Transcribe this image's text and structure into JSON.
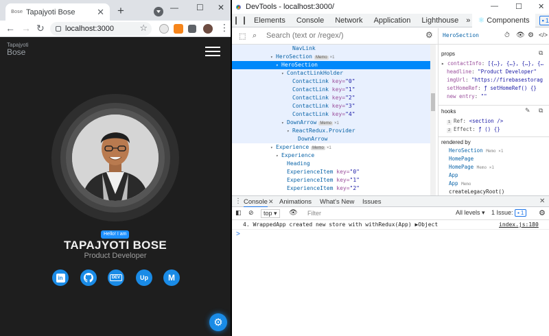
{
  "browser": {
    "tab_title": "Tapajyoti Bose",
    "tab_favicon_text": "Bose",
    "url": "localhost:3000",
    "new_tab_label": "+",
    "close_tab_label": "✕"
  },
  "site": {
    "logo_top": "Tapajyoti",
    "logo_bottom": "Bose",
    "hello_badge": "Hello! I am",
    "name": "TAPAJYOTI BOSE",
    "role": "Product Developer",
    "socials": [
      {
        "icon": "linkedin-icon",
        "label": "in"
      },
      {
        "icon": "github-icon",
        "label": "GH"
      },
      {
        "icon": "dev-icon",
        "label": "DEV"
      },
      {
        "icon": "upwork-icon",
        "label": "Up"
      },
      {
        "icon": "medium-icon",
        "label": "M"
      }
    ],
    "colors": {
      "accent": "#1a8be6",
      "background": "#1e1e1e"
    }
  },
  "devtools": {
    "window_title": "DevTools - localhost:3000/",
    "tabs": [
      "Elements",
      "Console",
      "Network",
      "Application",
      "Lighthouse",
      "Components"
    ],
    "active_tab": "Components",
    "issues_badge": "1",
    "search_placeholder": "Search (text or /regex/)",
    "tree": [
      {
        "name": "NavLink",
        "depth": 10,
        "state": "hl"
      },
      {
        "name": "HeroSection",
        "depth": 7,
        "memo": "Memo",
        "x1": "×1",
        "arrow": "▾",
        "state": "hl"
      },
      {
        "name": "HeroSection",
        "depth": 8,
        "arrow": "▾",
        "state": "sel"
      },
      {
        "name": "ContactLinkHolder",
        "depth": 9,
        "arrow": "▾",
        "state": "hl"
      },
      {
        "name": "ContactLink",
        "depth": 10,
        "key": "\"0\"",
        "state": "hl"
      },
      {
        "name": "ContactLink",
        "depth": 10,
        "key": "\"1\"",
        "state": "hl"
      },
      {
        "name": "ContactLink",
        "depth": 10,
        "key": "\"2\"",
        "state": "hl"
      },
      {
        "name": "ContactLink",
        "depth": 10,
        "key": "\"3\"",
        "state": "hl"
      },
      {
        "name": "ContactLink",
        "depth": 10,
        "key": "\"4\"",
        "state": "hl"
      },
      {
        "name": "DownArrow",
        "depth": 9,
        "memo": "Memo",
        "x1": "×1",
        "arrow": "▾",
        "state": "hl"
      },
      {
        "name": "ReactRedux.Provider",
        "depth": 10,
        "arrow": "▾",
        "state": "hl"
      },
      {
        "name": "DownArrow",
        "depth": 11,
        "state": "hl"
      },
      {
        "name": "Experience",
        "depth": 7,
        "memo": "Memo",
        "x1": "×1",
        "arrow": "▾",
        "state": ""
      },
      {
        "name": "Experience",
        "depth": 8,
        "arrow": "▾",
        "state": ""
      },
      {
        "name": "Heading",
        "depth": 9,
        "state": ""
      },
      {
        "name": "ExperienceItem",
        "depth": 9,
        "key": "\"0\"",
        "state": ""
      },
      {
        "name": "ExperienceItem",
        "depth": 9,
        "key": "\"1\"",
        "state": ""
      },
      {
        "name": "ExperienceItem",
        "depth": 9,
        "key": "\"2\"",
        "state": ""
      }
    ],
    "side": {
      "component": "HeroSection",
      "props_label": "props",
      "props": [
        {
          "k": "contactInfo",
          "v": "[{…}, {…}, {…}, {…"
        },
        {
          "k": "headline",
          "v": "\"Product Developer\""
        },
        {
          "k": "imgUrl",
          "v": "\"https://firebasestorag"
        },
        {
          "k": "setHomeRef",
          "v": "ƒ setHomeRef() {}"
        },
        {
          "k": "new entry",
          "v": "\"\""
        }
      ],
      "hooks_label": "hooks",
      "hooks": [
        {
          "idx": "1",
          "k": "Ref",
          "v": "<section />"
        },
        {
          "idx": "2",
          "k": "Effect",
          "v": "ƒ () {}"
        }
      ],
      "rendered_by_label": "rendered by",
      "rendered_by": [
        {
          "name": "HeroSection",
          "x1": "Memo ×1"
        },
        {
          "name": "HomePage",
          "x1": ""
        },
        {
          "name": "HomePage",
          "x1": "Memo ×1"
        },
        {
          "name": "App",
          "x1": ""
        },
        {
          "name": "App",
          "x1": "Memo"
        },
        {
          "name": "createLegacyRoot()",
          "x1": ""
        }
      ]
    },
    "drawer_tabs": [
      "Console",
      "Animations",
      "What's New",
      "Issues"
    ],
    "console": {
      "context": "top",
      "filter_placeholder": "Filter",
      "levels": "All levels ▾",
      "issues": "1 Issue:",
      "issues_count": "1",
      "message": "4. WrappedApp created new store with withRedux(App) ▶Object",
      "source": "index.js:180",
      "prompt": ">"
    }
  }
}
